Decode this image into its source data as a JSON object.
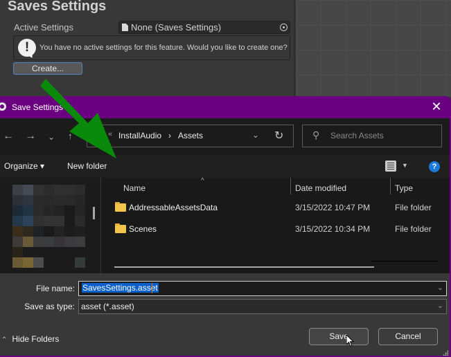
{
  "inspector": {
    "title": "Saves Settings",
    "active_settings_label": "Active Settings",
    "active_settings_value": "None (Saves Settings)",
    "help_message": "You have no active settings for this feature. Would you like to create one?",
    "create_button": "Create..."
  },
  "dialog": {
    "title": "Save Settings",
    "close_label": "✕",
    "nav": {
      "back": "←",
      "forward": "→",
      "recent": "⌄",
      "up": "↑"
    },
    "address": {
      "overflow": "«",
      "crumbs": [
        "InstallAudio",
        "Assets"
      ],
      "separator": "›",
      "dropdown": "⌄",
      "refresh": "↻"
    },
    "search_placeholder": "Search Assets",
    "toolbar": {
      "organize": "Organize ▾",
      "new_folder": "New folder",
      "view_dropdown": "▼",
      "help": "?"
    },
    "columns": [
      "Name",
      "Date modified",
      "Type"
    ],
    "sort_indicator": "^",
    "files": [
      {
        "name": "AddressableAssetsData",
        "date": "3/15/2022 10:47 PM",
        "type": "File folder"
      },
      {
        "name": "Scenes",
        "date": "3/15/2022 10:34 PM",
        "type": "File folder"
      }
    ],
    "file_name_label": "File name:",
    "file_name_value": "SavesSettings.asset",
    "save_type_label": "Save as type:",
    "save_type_value": "asset (*.asset)",
    "hide_folders": "Hide Folders",
    "hide_folders_icon": "⌃",
    "save_button": "Save",
    "cancel_button": "Cancel"
  },
  "colors": {
    "title_bar": "#6a007f",
    "annotation_arrow": "#0a8a0a",
    "selection": "#0a5fc8",
    "help_blue": "#1d79d8",
    "folder": "#f3c44b"
  }
}
